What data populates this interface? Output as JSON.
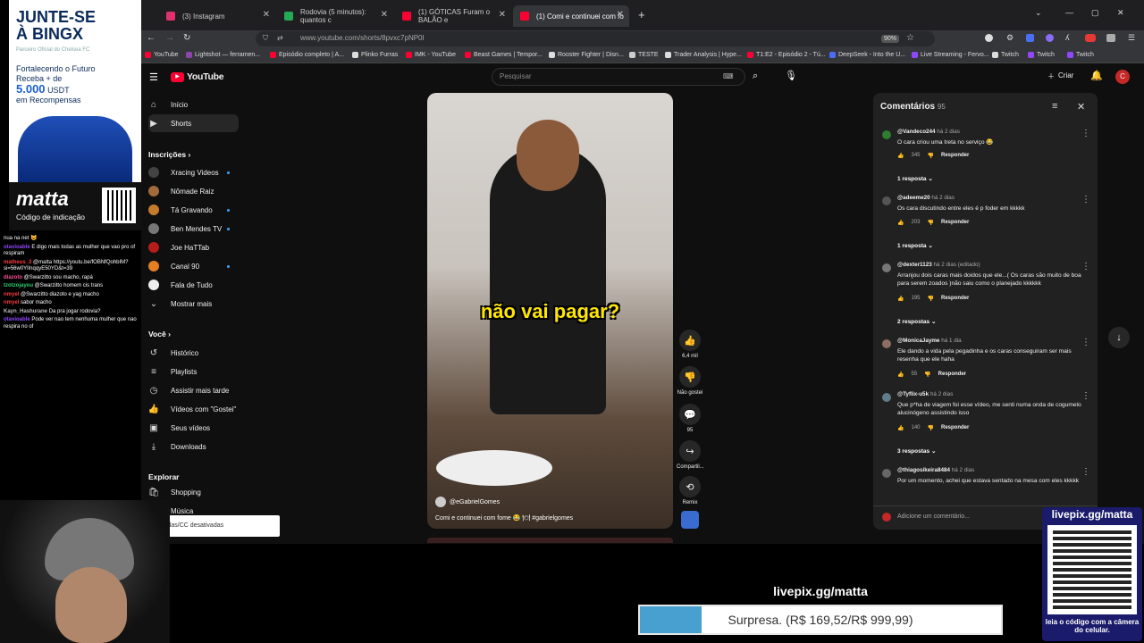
{
  "browser": {
    "tabs": [
      {
        "title": "(3) Instagram",
        "color": "#e1306c"
      },
      {
        "title": "Rodovia (5 minutos): quantos c",
        "color": "#22aa55"
      },
      {
        "title": "(1) GÓTICAS Furam o BALÃO e",
        "color": "#ff0033"
      },
      {
        "title": "(1) Comi e continuei com fo",
        "color": "#ff0033"
      }
    ],
    "url": "www.youtube.com/shorts/8pvxc7pNP0I",
    "zoom": "90%",
    "bookmarks": [
      "YouTube",
      "Lightshot — ferramen...",
      "Episódio completo | A...",
      "Plinko Furras",
      "IMK - YouTube",
      "Beast Games | Tempor...",
      "Rooster Fighter | Disn...",
      "TESTE",
      "Trader Analysis | Hype...",
      "T1:E2 - Episódio 2 - Tú...",
      "DeepSeek - Into the U...",
      "Live Streaming - Fervo...",
      "Twitch",
      "Twitch",
      "Twitch"
    ]
  },
  "youtube": {
    "logo": "YouTube",
    "search_placeholder": "Pesquisar",
    "create_label": "Criar",
    "avatar_letter": "C",
    "nav": {
      "home": "Início",
      "shorts": "Shorts"
    },
    "subs_title": "Inscrições",
    "subs": [
      "Xracing Videos",
      "Nômade Raiz",
      "Tá Gravando",
      "Ben Mendes TV",
      "Joe HaTTab",
      "Canal 90",
      "Fala de Tudo",
      "Mostrar mais"
    ],
    "you_title": "Você",
    "you": [
      "Histórico",
      "Playlists",
      "Assistir mais tarde",
      "Vídeos com \"Gostei\"",
      "Seus vídeos",
      "Downloads"
    ],
    "explore_title": "Explorar",
    "explore": [
      "Shopping",
      "Música"
    ],
    "tooltip": "Legendas/CC desativadas"
  },
  "video": {
    "caption": "não vai pagar?",
    "channel": "@eGabrielGomes",
    "title": "Comi e continuei com fome 😂 🍽 #gabrielgomes",
    "likes": "6,4 mil",
    "dislike_label": "Não gostei",
    "comments_count": "95",
    "share_label": "Compartil...",
    "remix_label": "Remix"
  },
  "comments_panel": {
    "title": "Comentários",
    "count": "95",
    "add_placeholder": "Adicione um comentário...",
    "reply_label": "Responder",
    "items": [
      {
        "user": "@Vandeco244",
        "time": "há 2 dias",
        "text": "O cara criou uma treta no serviço 😂",
        "likes": "345",
        "replies": "1 resposta",
        "color": "#2e7d32"
      },
      {
        "user": "@adeeme20",
        "time": "há 2 dias",
        "text": "Os cara discutindo entre eles é p foder em kkkkk",
        "likes": "203",
        "replies": "1 resposta",
        "color": "#555"
      },
      {
        "user": "@dexter1123",
        "time": "há 2 dias (editado)",
        "text": "Arranjou dois caras mais doidos que ele...( Os caras são muito de boa para serem zoados )não saiu como o planejado kkkkkk",
        "likes": "195",
        "replies": "2 respostas",
        "color": "#777"
      },
      {
        "user": "@MonicaJayme",
        "time": "há 1 dia",
        "text": "Ele dando a vida pela pegadinha e os caras conseguiram ser mais resenha que ele haha",
        "likes": "55",
        "replies": "",
        "color": "#8d6e63"
      },
      {
        "user": "@Tyflix-u5k",
        "time": "há 2 dias",
        "text": "Que p*ha de viagem foi esse vídeo, me senti numa onda de cogumelo alucinógeno assistindo isso",
        "likes": "140",
        "replies": "3 respostas",
        "color": "#607d8b"
      },
      {
        "user": "@thiagosikeira8484",
        "time": "há 2 dias",
        "text": "Por um momento, achei que estava sentado na mesa com eles kkkkk",
        "likes": "",
        "replies": "",
        "color": "#666"
      }
    ]
  },
  "overlay": {
    "promo_line1": "JUNTE-SE",
    "promo_line2": "À BINGX",
    "promo_sub": "Parceiro Oficial do Chelsea FC",
    "promo_text1": "Fortalecendo o Futuro",
    "promo_text2": "Receba + de",
    "promo_amount": "5.000",
    "promo_currency": "USDT",
    "promo_text3": "em Recompensas",
    "brand": "matta",
    "brand_sub": "Código de indicação",
    "chat": [
      {
        "user": "",
        "msg": "nua na net 😺",
        "color": "#fff"
      },
      {
        "user": "otavioable",
        "msg": "E digo mais todas as mulher que vao pro of respiram",
        "color": "#9146ff"
      },
      {
        "user": "matheus_3",
        "msg": "@matta https://youtu.be/fOBNfQohbIM?si=56w0YlInqqyE50YD&t=39",
        "color": "#ff3b3b"
      },
      {
        "user": "diazoto",
        "msg": "@Swarzitto sou macho, rapá",
        "color": "#ff4f9a"
      },
      {
        "user": "tzotzojayou",
        "msg": "@Swarzitto homem cis trans",
        "color": "#2ecc71"
      },
      {
        "user": "nmyel",
        "msg": "@Swarzitto diazoto e yag macho",
        "color": "#ff3b3b"
      },
      {
        "user": "nmyel",
        "msg": "sabor macho",
        "color": "#ff3b3b"
      },
      {
        "user": "Kayn_Hashurane",
        "msg": "Da pra jogar rodovia?",
        "color": "#bbb"
      },
      {
        "user": "otavioable",
        "msg": "Pode ver nao tem nenhuma mulher que nao respira no of",
        "color": "#9146ff"
      }
    ],
    "livepix": "livepix.gg/matta",
    "qr_caption": "leia o código com a câmera do celular.",
    "goal_label": "livepix.gg/matta",
    "goal_text": "Surpresa. (R$ 169,52/R$ 999,99)",
    "goal_progress": 0.17
  }
}
